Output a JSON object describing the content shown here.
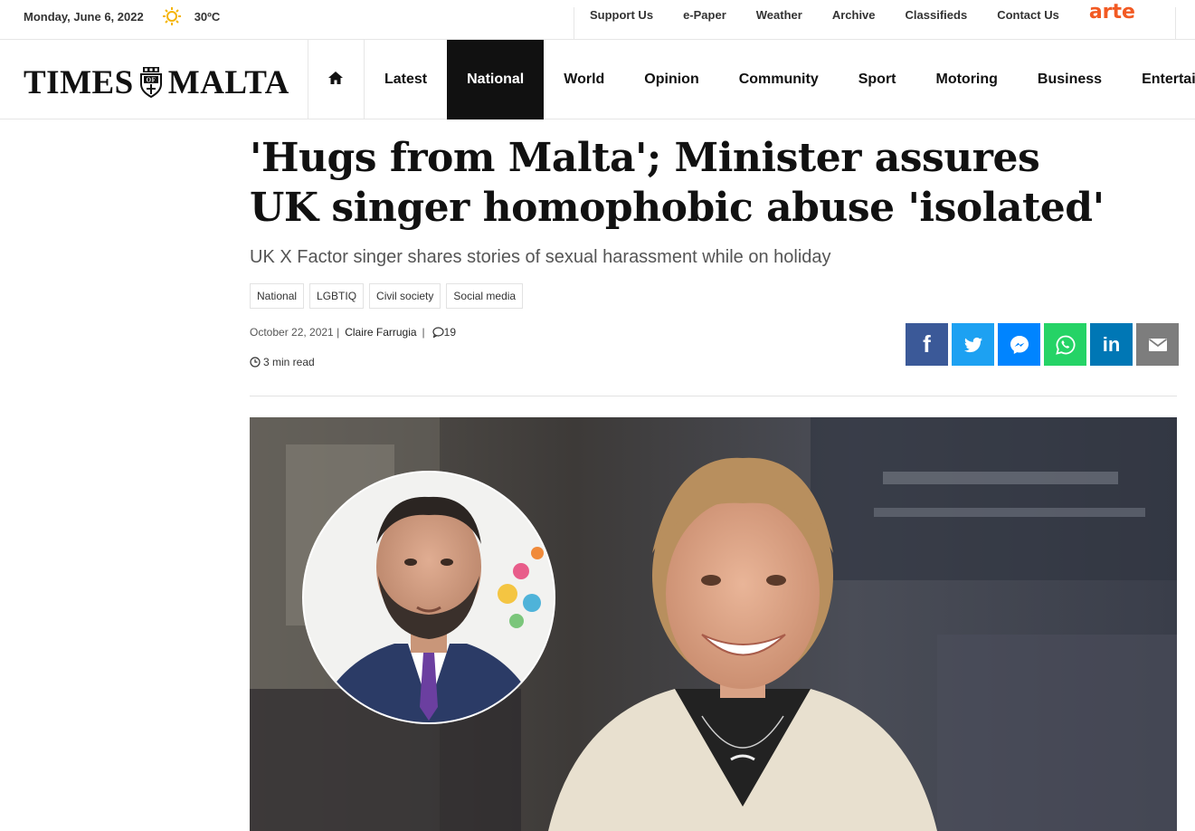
{
  "topbar": {
    "date": "Monday, June 6, 2022",
    "weather_icon": "sun-icon",
    "temperature": "30ºC",
    "links": [
      "Support Us",
      "e-Paper",
      "Weather",
      "Archive",
      "Classifieds",
      "Contact Us"
    ],
    "partner_logo": "arte"
  },
  "nav": {
    "logo_left": "TIMES",
    "logo_right": "MALTA",
    "home_icon": "home-icon",
    "items": [
      "Latest",
      "National",
      "World",
      "Opinion",
      "Community",
      "Sport",
      "Motoring",
      "Business",
      "Entertai"
    ],
    "active": "National"
  },
  "article": {
    "headline": "'Hugs from Malta'; Minister assures UK singer homophobic abuse 'isolated'",
    "standfirst": "UK X Factor singer shares stories of sexual harassment while on holiday",
    "tags": [
      "National",
      "LGBTIQ",
      "Civil society",
      "Social media"
    ],
    "date": "October 22, 2021 |",
    "author": "Claire Farrugia",
    "comments": "19",
    "read_time": "3 min read"
  },
  "share": {
    "buttons": [
      {
        "name": "facebook",
        "label": "f",
        "color": "#3b5998"
      },
      {
        "name": "twitter",
        "label": "",
        "color": "#1da1f2"
      },
      {
        "name": "messenger",
        "label": "",
        "color": "#0084ff"
      },
      {
        "name": "whatsapp",
        "label": "",
        "color": "#25d366"
      },
      {
        "name": "linkedin",
        "label": "in",
        "color": "#0077b5"
      },
      {
        "name": "email",
        "label": "",
        "color": "#7d7d7d"
      }
    ]
  },
  "colors": {
    "nav_active_bg": "#111111",
    "arte_orange": "#f25a23"
  }
}
